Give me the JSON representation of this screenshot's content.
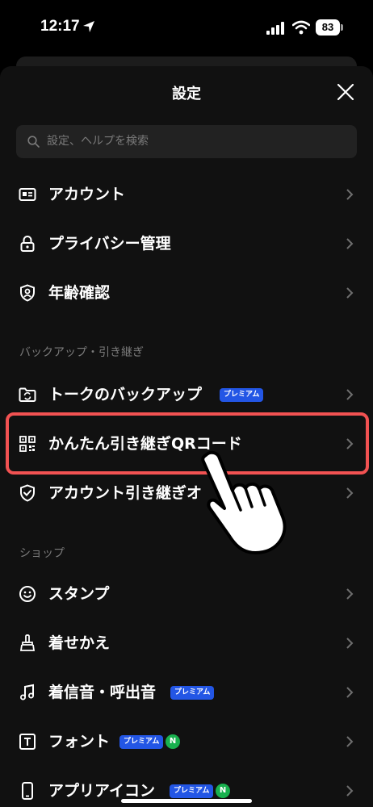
{
  "status_bar": {
    "time": "12:17",
    "battery": "83"
  },
  "header": {
    "title": "設定"
  },
  "search": {
    "placeholder": "設定、ヘルプを検索"
  },
  "sections": {
    "backup": "バックアップ・引き継ぎ",
    "shop": "ショップ"
  },
  "rows": {
    "account": "アカウント",
    "privacy": "プライバシー管理",
    "age": "年齢確認",
    "talk_backup": "トークのバックアップ",
    "qr_transfer": "かんたん引き継ぎQRコード",
    "account_transfer": "アカウント引き継ぎオ",
    "stamp": "スタンプ",
    "theme": "着せかえ",
    "ringtone": "着信音・呼出音",
    "font": "フォント",
    "app_icon": "アプリアイコン"
  },
  "badges": {
    "premium": "プレミアム",
    "new": "N"
  },
  "icons": [
    "location-arrow-icon",
    "signal-icon",
    "wifi-icon",
    "close-icon",
    "search-icon",
    "id-card-icon",
    "lock-icon",
    "shield-person-icon",
    "folder-sync-icon",
    "qr-code-icon",
    "shield-check-icon",
    "smiley-icon",
    "brush-icon",
    "music-note-icon",
    "font-t-icon",
    "phone-icon",
    "chevron-right-icon",
    "pointing-hand-icon"
  ],
  "colors": {
    "background": "#111111",
    "highlight": "#f25252",
    "premium_badge": "#2356e5",
    "new_badge": "#18b14e"
  }
}
